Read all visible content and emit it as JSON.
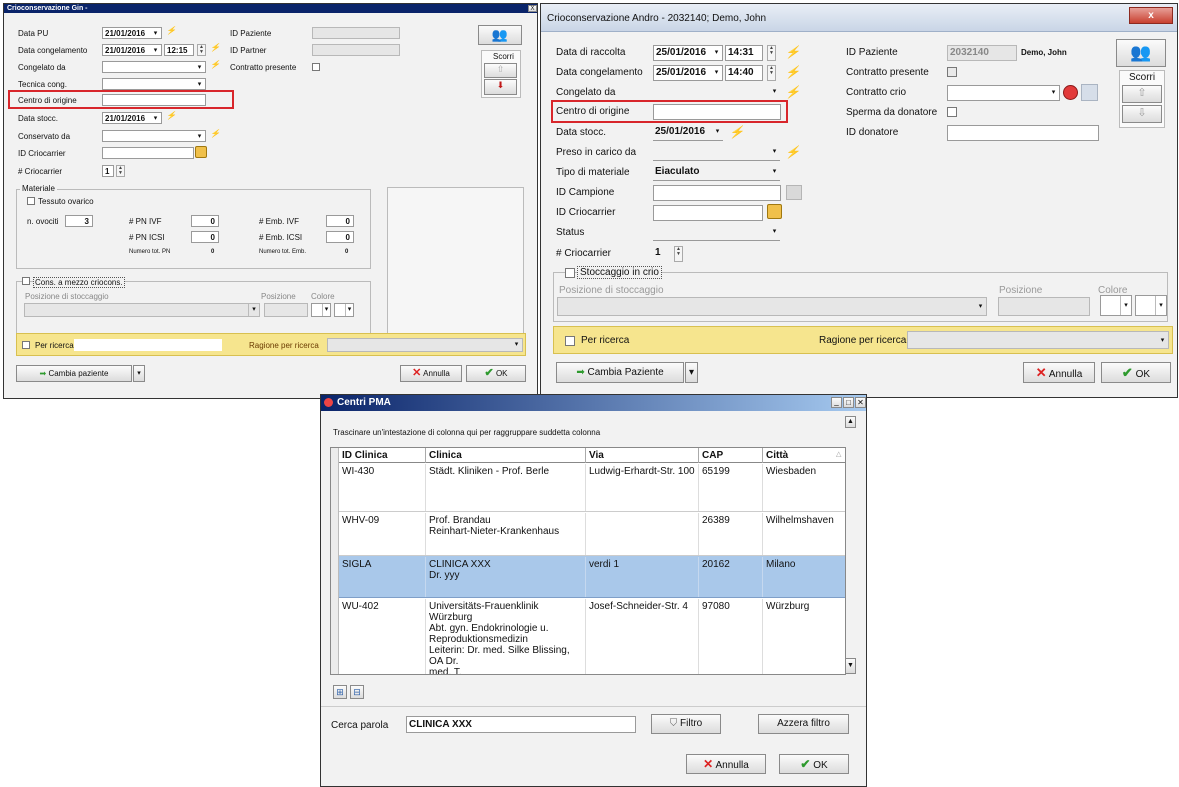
{
  "gin": {
    "title": "Crioconservazione Gin  -",
    "close": "X",
    "data_pu_label": "Data PU",
    "data_pu_value": "21/01/2016",
    "data_cong_label": "Data congelamento",
    "data_cong_value": "21/01/2016",
    "data_cong_time": "12:15",
    "congelato_da_label": "Congelato da",
    "tecnica_label": "Tecnica cong.",
    "centro_label": "Centro di origine",
    "data_stocc_label": "Data stocc.",
    "data_stocc_value": "21/01/2016",
    "conservato_label": "Conservato da",
    "id_crio_label": "ID Criocarrier",
    "n_crio_label": "# Criocarrier",
    "n_crio_value": "1",
    "id_paziente_label": "ID Paziente",
    "id_partner_label": "ID Partner",
    "contratto_label": "Contratto presente",
    "scorri_label": "Scorri",
    "materiale_label": "Materiale",
    "tessuto_label": "Tessuto ovarico",
    "ovociti_label": "n. ovociti",
    "ovociti_value": "3",
    "pn_ivf_label": "# PN IVF",
    "pn_ivf_value": "0",
    "pn_icsi_label": "# PN ICSI",
    "pn_icsi_value": "0",
    "emb_ivf_label": "# Emb. IVF",
    "emb_ivf_value": "0",
    "emb_icsi_label": "# Emb. ICSI",
    "emb_icsi_value": "0",
    "tot_pn_label": "Numero tot. PN",
    "tot_pn_value": "0",
    "tot_emb_label": "Numero tot. Emb.",
    "tot_emb_value": "0",
    "cons_label": "Cons. a mezzo criocons.",
    "posizione_stocc_label": "Posizione di stoccaggio",
    "posizione_label": "Posizione",
    "colore_label": "Colore",
    "ricerca_label": "Per ricerca",
    "ragione_label": "Ragione per ricerca",
    "cambia_label": "Cambia paziente",
    "annulla_label": "Annulla",
    "ok_label": "OK"
  },
  "andro": {
    "title": "Crioconservazione Andro  - 2032140; Demo, John",
    "close": "x",
    "data_raccolta_label": "Data di raccolta",
    "data_raccolta_value": "25/01/2016",
    "data_raccolta_time": "14:31",
    "data_cong_label": "Data congelamento",
    "data_cong_value": "25/01/2016",
    "data_cong_time": "14:40",
    "congelato_label": "Congelato da",
    "centro_label": "Centro di origine",
    "data_stocc_label": "Data stocc.",
    "data_stocc_value": "25/01/2016",
    "preso_label": "Preso in carico da",
    "tipo_label": "Tipo di materiale",
    "tipo_value": "Eiaculato",
    "id_campione_label": "ID Campione",
    "id_crio_label": "ID Criocarrier",
    "status_label": "Status",
    "n_crio_label": "# Criocarrier",
    "n_crio_value": "1",
    "id_paziente_label": "ID Paziente",
    "id_paziente_value": "2032140",
    "patient_name": "Demo, John",
    "contratto_label": "Contratto presente",
    "contratto_crio_label": "Contratto crio",
    "sperma_label": "Sperma da donatore",
    "id_donatore_label": "ID donatore",
    "scorri_label": "Scorri",
    "stocc_label": "Stoccaggio in crio",
    "posizione_stocc_label": "Posizione di stoccaggio",
    "posizione_label": "Posizione",
    "colore_label": "Colore",
    "ricerca_label": "Per ricerca",
    "ragione_label": "Ragione per ricerca",
    "cambia_label": "Cambia Paziente",
    "annulla_label": "Annulla",
    "ok_label": "OK"
  },
  "centri": {
    "title": "Centri PMA",
    "group_hint": "Trascinare un'intestazione di colonna qui per raggruppare suddetta colonna",
    "columns": [
      "ID Clinica",
      "Clinica",
      "Via",
      "CAP",
      "Città"
    ],
    "rows": [
      {
        "id": "WI-430",
        "clinica": "Städt. Kliniken - Prof. Berle",
        "via": "Ludwig-Erhardt-Str. 100",
        "cap": "65199",
        "citta": "Wiesbaden"
      },
      {
        "id": "WHV-09",
        "clinica": "Prof. Brandau\nReinhart-Nieter-Krankenhaus",
        "via": "",
        "cap": "26389",
        "citta": "Wilhelmshaven"
      },
      {
        "id": "SIGLA",
        "clinica": "CLINICA XXX\nDr. yyy",
        "via": "verdi 1",
        "cap": "20162",
        "citta": "Milano"
      },
      {
        "id": "WU-402",
        "clinica": "Universitäts-Frauenklinik Würzburg\nAbt. gyn. Endokrinologie u.\nReproduktionsmedizin\nLeiterin: Dr. med. Silke Blissing, OA Dr.\nmed. T.\nFrambach, Dr. med. Th. Bernar,  PD Dr.\nL. Rieger",
        "via": "Josef-Schneider-Str. 4",
        "cap": "97080",
        "citta": "Würzburg"
      }
    ],
    "cerca_label": "Cerca parola",
    "cerca_value": "CLINICA XXX",
    "filtro_label": "Filtro",
    "azzera_label": "Azzera filtro",
    "annulla_label": "Annulla",
    "ok_label": "OK"
  },
  "colors": {
    "title_blue": "#0a246a",
    "highlight_red": "#d8262b",
    "selected_row": "#a9c8ea",
    "ricerca_yellow": "#f6e58e"
  }
}
